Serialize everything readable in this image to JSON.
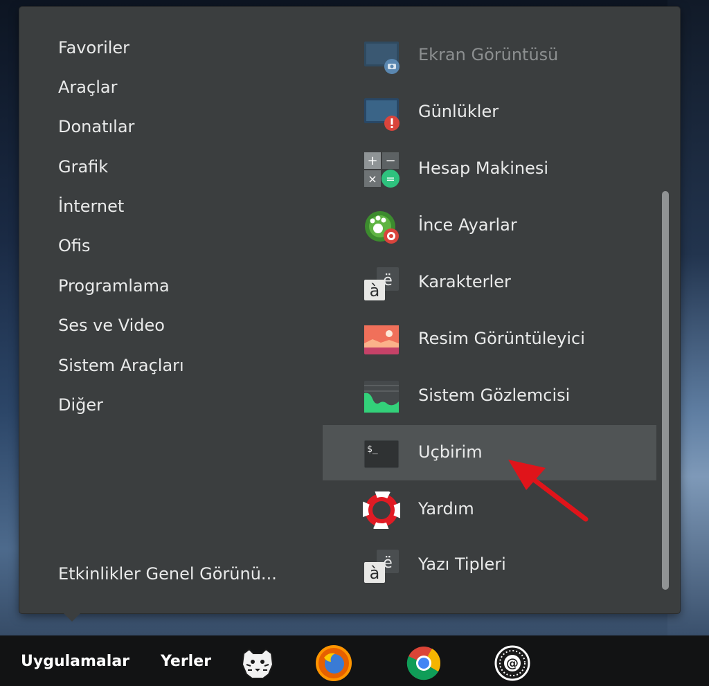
{
  "categories": [
    {
      "label": "Favoriler"
    },
    {
      "label": "Araçlar"
    },
    {
      "label": "Donatılar"
    },
    {
      "label": "Grafik"
    },
    {
      "label": "İnternet"
    },
    {
      "label": "Ofis"
    },
    {
      "label": "Programlama"
    },
    {
      "label": "Ses ve Video"
    },
    {
      "label": "Sistem Araçları"
    },
    {
      "label": "Diğer"
    }
  ],
  "activities_label": "Etkinlikler Genel Görünü...",
  "apps": [
    {
      "label": "Ekran Görüntüsü",
      "icon": "screenshot-icon",
      "state": "dimmed"
    },
    {
      "label": "Günlükler",
      "icon": "logs-icon"
    },
    {
      "label": "Hesap Makinesi",
      "icon": "calculator-icon"
    },
    {
      "label": "İnce Ayarlar",
      "icon": "tweaks-icon"
    },
    {
      "label": "Karakterler",
      "icon": "characters-icon"
    },
    {
      "label": "Resim Görüntüleyici",
      "icon": "image-viewer-icon"
    },
    {
      "label": "Sistem Gözlemcisi",
      "icon": "system-monitor-icon"
    },
    {
      "label": "Uçbirim",
      "icon": "terminal-icon",
      "state": "highlighted"
    },
    {
      "label": "Yardım",
      "icon": "help-icon"
    },
    {
      "label": "Yazı Tipleri",
      "icon": "fonts-icon"
    }
  ],
  "icon_text": {
    "characters_big": "à",
    "characters_small": "ë",
    "terminal_prompt": "$_"
  },
  "taskbar": {
    "applications_label": "Uygulamalar",
    "places_label": "Yerler",
    "icons": [
      "pardus-icon",
      "firefox-icon",
      "chrome-icon",
      "mail-icon"
    ]
  },
  "colors": {
    "menu_bg": "#3b3e3f",
    "highlight_bg": "#505455",
    "taskbar_bg": "#121314",
    "arrow": "#e0141a"
  }
}
